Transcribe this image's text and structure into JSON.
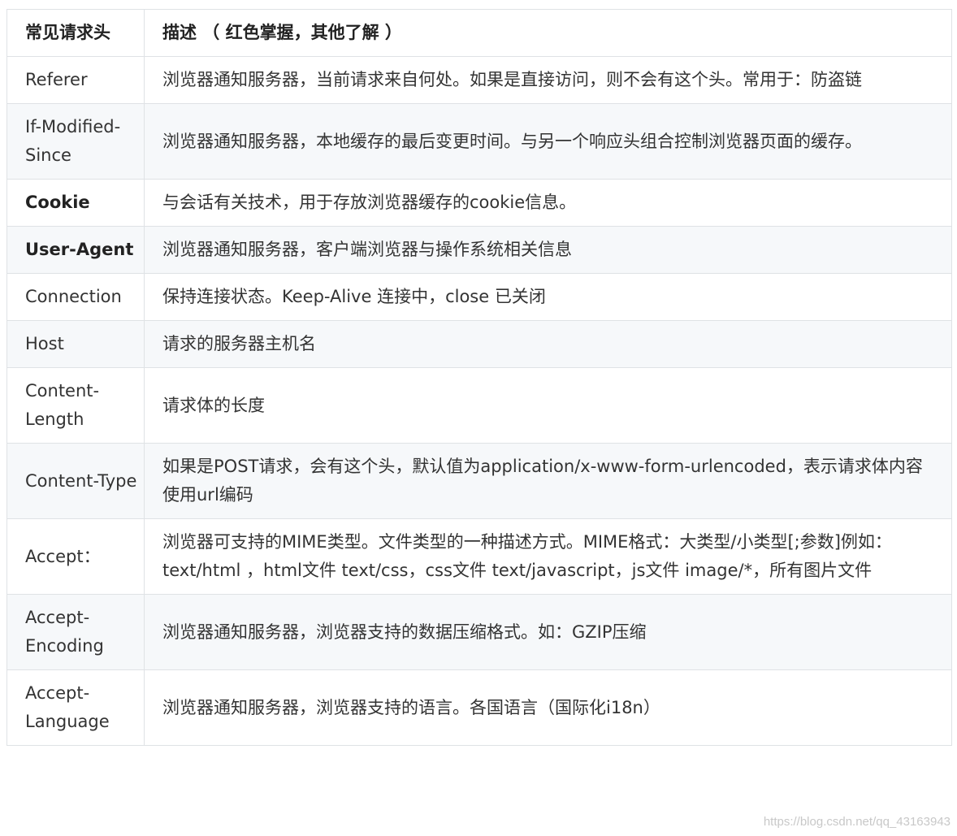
{
  "table": {
    "headers": [
      "常见请求头",
      "描述 （ 红色掌握，其他了解 ）"
    ],
    "rows": [
      {
        "name": "Referer",
        "desc": "浏览器通知服务器，当前请求来自何处。如果是直接访问，则不会有这个头。常用于：防盗链",
        "bold": false
      },
      {
        "name": "If-Modified-Since",
        "desc": "浏览器通知服务器，本地缓存的最后变更时间。与另一个响应头组合控制浏览器页面的缓存。",
        "bold": false
      },
      {
        "name": "Cookie",
        "desc": "与会话有关技术，用于存放浏览器缓存的cookie信息。",
        "bold": true
      },
      {
        "name": "User-Agent",
        "desc": "浏览器通知服务器，客户端浏览器与操作系统相关信息",
        "bold": true
      },
      {
        "name": "Connection",
        "desc": "保持连接状态。Keep-Alive 连接中，close 已关闭",
        "bold": false
      },
      {
        "name": "Host",
        "desc": "请求的服务器主机名",
        "bold": false
      },
      {
        "name": "Content-Length",
        "desc": "请求体的长度",
        "bold": false
      },
      {
        "name": "Content-Type",
        "desc": "如果是POST请求，会有这个头，默认值为application/x-www-form-urlencoded，表示请求体内容使用url编码",
        "bold": false
      },
      {
        "name": "Accept：",
        "desc": "浏览器可支持的MIME类型。文件类型的一种描述方式。MIME格式：大类型/小类型[;参数]例如： text/html ，html文件 text/css，css文件 text/javascript，js文件 image/*，所有图片文件",
        "bold": false
      },
      {
        "name": "Accept-Encoding",
        "desc": "浏览器通知服务器，浏览器支持的数据压缩格式。如：GZIP压缩",
        "bold": false
      },
      {
        "name": "Accept-Language",
        "desc": "浏览器通知服务器，浏览器支持的语言。各国语言（国际化i18n）",
        "bold": false
      }
    ]
  },
  "watermark": "https://blog.csdn.net/qq_43163943"
}
